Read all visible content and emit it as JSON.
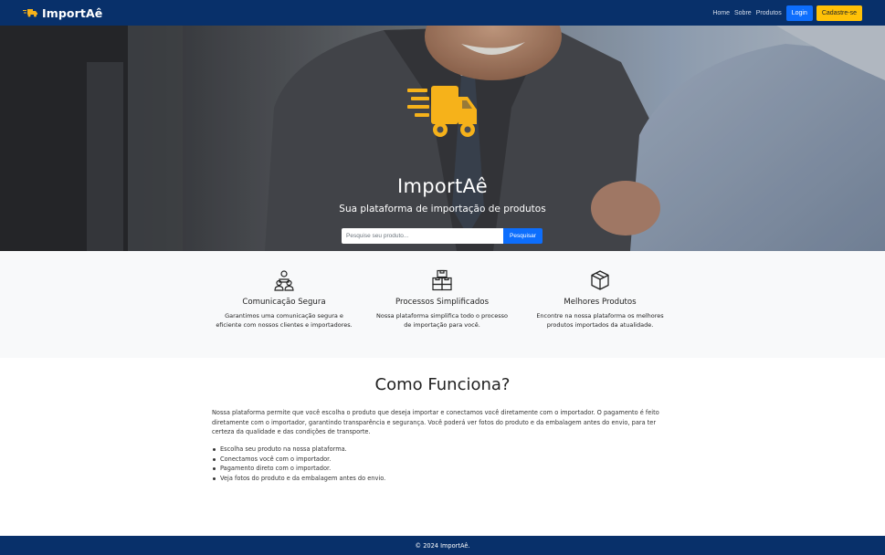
{
  "navbar": {
    "brand": "ImportAê",
    "links": [
      "Home",
      "Sobre",
      "Produtos"
    ],
    "login_label": "Login",
    "signup_label": "Cadastre-se"
  },
  "hero": {
    "title": "ImportAê",
    "subtitle": "Sua plataforma de importação de produtos",
    "search_placeholder": "Pesquise seu produto...",
    "search_button": "Pesquisar"
  },
  "features": [
    {
      "icon": "people-icon",
      "title": "Comunicação Segura",
      "text_lines": [
        "Garantimos uma comunicação segura e",
        "eficiente com nossos clientes e importadores."
      ]
    },
    {
      "icon": "boxes-icon",
      "title": "Processos Simplificados",
      "text_lines": [
        "Nossa plataforma simplifica todo o processo",
        "de importação para você."
      ]
    },
    {
      "icon": "box-icon",
      "title": "Melhores Produtos",
      "text_lines": [
        "Encontre na nossa plataforma os melhores",
        "produtos importados da atualidade."
      ]
    }
  ],
  "how": {
    "title": "Como Funciona?",
    "paragraph_lines": [
      "Nossa plataforma permite que você escolha o produto que deseja importar e conectamos você diretamente com o importador. O pagamento é feito",
      "diretamente com o importador, garantindo transparência e segurança. Você poderá ver fotos do produto e da embalagem antes do envio, para ter",
      "certeza da qualidade e das condições de transporte."
    ],
    "steps": [
      "Escolha seu produto na nossa plataforma.",
      "Conectamos você com o importador.",
      "Pagamento direto com o importador.",
      "Veja fotos do produto e da embalagem antes do envio."
    ]
  },
  "footer": {
    "text": "© 2024 ImportAê."
  },
  "colors": {
    "navbar": "#08306a",
    "accent_yellow": "#ffc107",
    "primary_blue": "#0d6efd",
    "truck_yellow": "#f6b21a"
  }
}
